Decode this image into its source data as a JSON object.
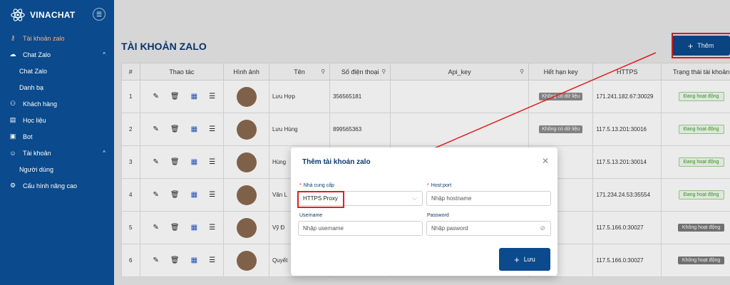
{
  "brand": {
    "name": "VINACHAT"
  },
  "sidebar": {
    "items": [
      {
        "label": "Tài khoản zalo",
        "icon": "user-lock-icon",
        "active": true
      },
      {
        "label": "Chat Zalo",
        "icon": "chat-icon",
        "caret": "^"
      },
      {
        "label": "Chat Zalo",
        "sub": true
      },
      {
        "label": "Danh bạ",
        "sub": true
      },
      {
        "label": "Khách hàng",
        "icon": "users-icon"
      },
      {
        "label": "Học liệu",
        "icon": "document-icon"
      },
      {
        "label": "Bot",
        "icon": "bot-icon"
      },
      {
        "label": "Tài khoản",
        "icon": "person-icon",
        "caret": "^"
      },
      {
        "label": "Người dùng",
        "sub": true
      },
      {
        "label": "Cấu hình nâng cao",
        "icon": "gear-icon"
      }
    ]
  },
  "header": {
    "title": "TÀI KHOẢN ZALO",
    "add_label": "Thêm"
  },
  "table": {
    "columns": [
      "#",
      "Thao tác",
      "Hình ảnh",
      "Tên",
      "Số điện thoại",
      "Api_key",
      "Hết hạn key",
      "HTTPS",
      "Trạng thái tài khoản"
    ],
    "rows": [
      {
        "no": "1",
        "name": "Lưu Hợp",
        "phone": "356565181",
        "api_key": "",
        "expiry": "Không có dữ liệu",
        "https": "171.241.182.67:30029",
        "status": "Đang hoạt động",
        "status_type": "green"
      },
      {
        "no": "2",
        "name": "Lưu Hùng",
        "phone": "899565363",
        "api_key": "",
        "expiry": "Không có dữ liệu",
        "https": "117.5.13.201:30016",
        "status": "Đang hoạt động",
        "status_type": "green"
      },
      {
        "no": "3",
        "name": "Hùng",
        "phone": "",
        "api_key": "",
        "expiry": "",
        "https": "117.5.13.201:30014",
        "status": "Đang hoạt động",
        "status_type": "green"
      },
      {
        "no": "4",
        "name": "Văn L",
        "phone": "",
        "api_key": "",
        "expiry": "",
        "https": "171.234.24.53:35554",
        "status": "Đang hoạt động",
        "status_type": "green"
      },
      {
        "no": "5",
        "name": "Vỹ Đ",
        "phone": "",
        "api_key": "",
        "expiry": "",
        "https": "117.5.166.0:30027",
        "status": "Không hoạt động",
        "status_type": "dark"
      },
      {
        "no": "6",
        "name": "Quyết",
        "phone": "",
        "api_key": "",
        "expiry": "",
        "https": "117.5.166.0:30027",
        "status": "Không hoạt động",
        "status_type": "dark"
      }
    ]
  },
  "modal": {
    "title": "Thêm tài khoản zalo",
    "provider_label": "Nhà cung cấp",
    "provider_value": "HTTPS Proxy",
    "host_label": "Host:port",
    "host_placeholder": "Nhập hostname",
    "username_label": "Username",
    "username_placeholder": "Nhập username",
    "password_label": "Password",
    "password_placeholder": "Nhập pasword",
    "save_label": "Lưu"
  },
  "colors": {
    "sidebar": "#0b4a8c",
    "accent": "#0b4a8c",
    "highlight": "#e02020"
  }
}
